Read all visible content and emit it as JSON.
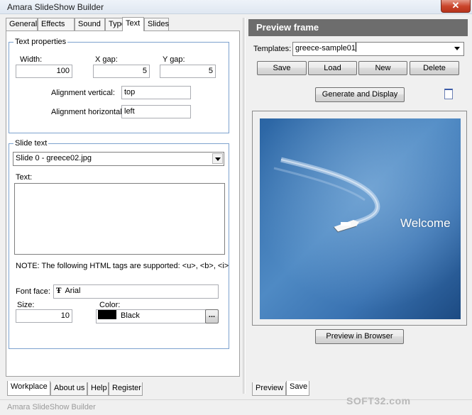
{
  "window": {
    "title": "Amara SlideShow Builder",
    "close_glyph": "✕"
  },
  "left_tabs": [
    "General",
    "Effects",
    "Sound",
    "Type",
    "Text",
    "Slides"
  ],
  "active_left_tab": "Text",
  "text_properties": {
    "legend": "Text properties",
    "width_label": "Width:",
    "width_value": "100",
    "xgap_label": "X gap:",
    "xgap_value": "5",
    "ygap_label": "Y gap:",
    "ygap_value": "5",
    "align_v_label": "Alignment vertical:",
    "align_v_value": "top",
    "align_h_label": "Alignment horizontal:",
    "align_h_value": "left"
  },
  "slide_text": {
    "legend": "Slide text",
    "slide_select": "Slide 0 - greece02.jpg",
    "text_label": "Text:",
    "text_value": "",
    "note": "NOTE: The following HTML tags are supported: <u>, <b>, <i>",
    "font_face_label": "Font face:",
    "font_face_value": "Arial",
    "size_label": "Size:",
    "size_value": "10",
    "color_label": "Color:",
    "color_value": "Black",
    "color_hex": "#000000",
    "color_more": "..."
  },
  "bottom_tabs_left": [
    "Workplace",
    "About us",
    "Help",
    "Register"
  ],
  "preview": {
    "header": "Preview frame",
    "templates_label": "Templates:",
    "templates_value": "greece-sample01",
    "buttons": {
      "save": "Save",
      "load": "Load",
      "new": "New",
      "delete": "Delete"
    },
    "generate": "Generate and Display",
    "image_caption": "Welcome",
    "preview_browser": "Preview in Browser"
  },
  "bottom_tabs_right": [
    "Preview",
    "Save"
  ],
  "status_text": "Amara SlideShow Builder",
  "watermark": "SOFT32.com",
  "colors": {
    "header_bg": "#6d6d6d",
    "group_border": "#7da2ce",
    "sea_dark": "#1f4f85",
    "sea_light": "#5e95c8"
  }
}
